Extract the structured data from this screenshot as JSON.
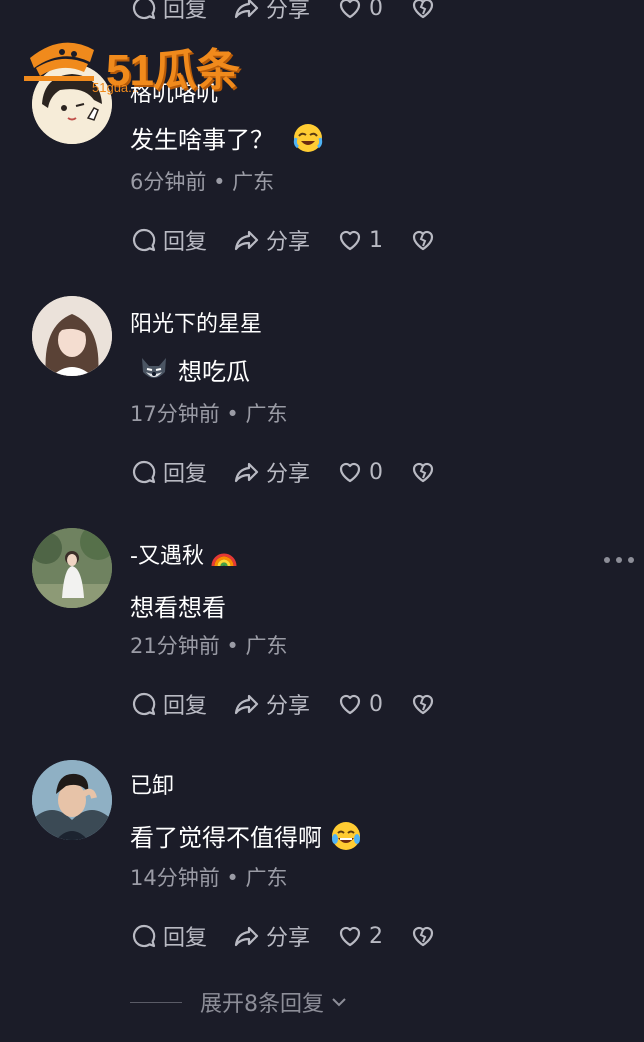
{
  "watermark": {
    "brand": "51瓜条",
    "sub": "51gua..."
  },
  "actions": {
    "reply": "回复",
    "share": "分享"
  },
  "top_row": {
    "likes": "0"
  },
  "comments": [
    {
      "name": "格叽咯叽",
      "text": "发生啥事了？",
      "time": "6分钟前",
      "region": "广东",
      "likes": "1",
      "emoji": "laugh-cry"
    },
    {
      "name": "阳光下的星星",
      "text": "想吃瓜",
      "time": "17分钟前",
      "region": "广东",
      "likes": "0",
      "emoji": "wolf-face"
    },
    {
      "name": "-又遇秋",
      "text": "想看想看",
      "time": "21分钟前",
      "region": "广东",
      "likes": "0",
      "emoji": "rainbow"
    },
    {
      "name": "已卸",
      "text": "看了觉得不值得啊",
      "time": "14分钟前",
      "region": "广东",
      "likes": "2",
      "emoji": "joy"
    }
  ],
  "expand_label": "展开8条回复",
  "colors": {
    "background": "#1b1c28",
    "muted": "#9a9ba5",
    "accent": "#f08a1c"
  }
}
